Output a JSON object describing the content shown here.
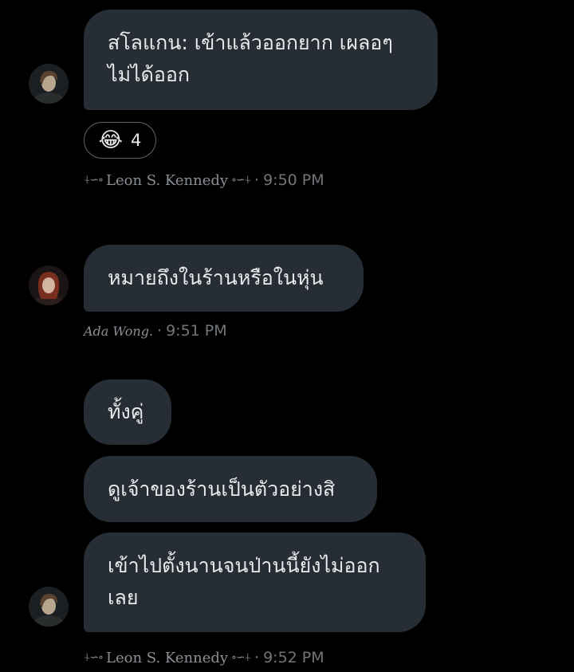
{
  "messages": [
    {
      "text_line1": "สโลแกน: เข้าแล้วออกยาก เผลอๆ",
      "text_line2": "ไม่ได้ออก"
    },
    {
      "text": "หมายถึงในร้านหรือในหุ่น"
    },
    {
      "text": "ทั้งคู่"
    },
    {
      "text": "ดูเจ้าของร้านเป็นตัวอย่างสิ"
    },
    {
      "text_line1": "เข้าไปตั้งนานจนป่านนี้ยังไม่ออก",
      "text_line2": "เลย"
    }
  ],
  "reaction": {
    "emoji": "😂",
    "count": "4"
  },
  "meta": [
    {
      "orn_left": "⍭∽∘",
      "sender": "Leon S. Kennedy",
      "orn_right": "∘∽⍭",
      "separator": "·",
      "time": "9:50 PM"
    },
    {
      "sender": "Ada Wong.",
      "separator": "·",
      "time": "9:51 PM"
    },
    {
      "orn_left": "⍭∽∘",
      "sender": "Leon S. Kennedy",
      "orn_right": "∘∽⍭",
      "separator": "·",
      "time": "9:52 PM"
    }
  ],
  "colors": {
    "background": "#000000",
    "bubble": "#262d34",
    "text": "#e7e9ea",
    "meta_text": "#71767b"
  }
}
